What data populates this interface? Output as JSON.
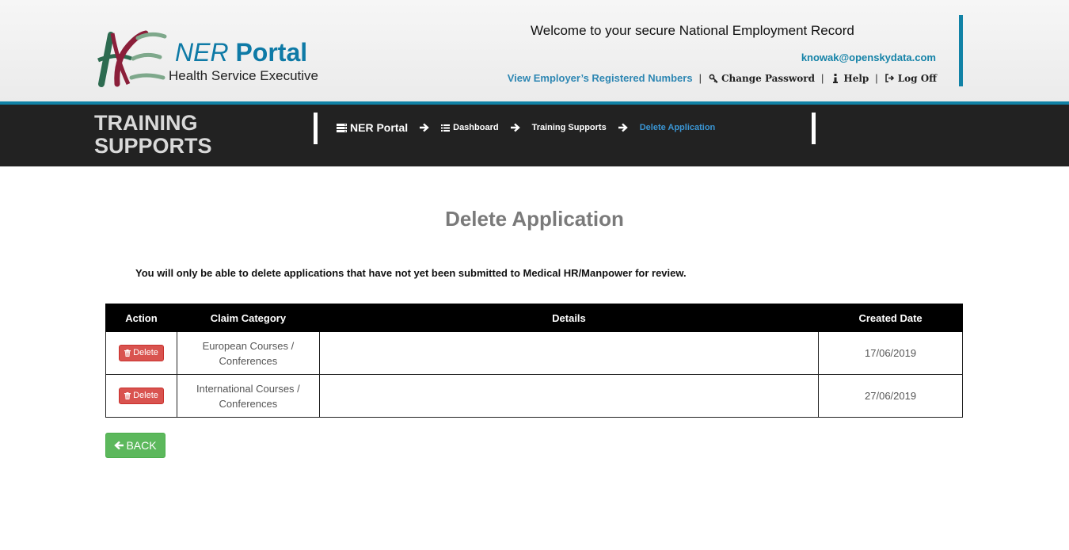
{
  "header": {
    "logo_title_italic": "NER",
    "logo_title_bold": "Portal",
    "logo_subtitle": "Health Service Executive",
    "welcome": "Welcome to your secure National Employment Record",
    "user_email": "knowak@openskydata.com",
    "links": {
      "registered_numbers": "View Employer’s Registered Numbers",
      "change_password": "Change Password",
      "help": "Help",
      "log_off": "Log Off",
      "separator": "|"
    }
  },
  "nav": {
    "section_title_line1": "TRAINING",
    "section_title_line2": "SUPPORTS",
    "breadcrumb": [
      "NER Portal",
      "Dashboard",
      "Training Supports",
      "Delete Application"
    ]
  },
  "main": {
    "page_title": "Delete Application",
    "note": "You will only be able to delete applications that have not yet been submitted to Medical HR/Manpower for review.",
    "table": {
      "headers": [
        "Action",
        "Claim Category",
        "Details",
        "Created Date"
      ],
      "rows": [
        {
          "action": "Delete",
          "category_line1": "European Courses /",
          "category_line2": "Conferences",
          "details": "",
          "created": "17/06/2019"
        },
        {
          "action": "Delete",
          "category_line1": "International Courses /",
          "category_line2": "Conferences",
          "details": "",
          "created": "27/06/2019"
        }
      ]
    },
    "back_label": "BACK"
  },
  "colors": {
    "accent": "#1182a6",
    "nav_bg": "#222222",
    "delete": "#d9534f",
    "back": "#5cb85c",
    "current_crumb": "#3a95d3"
  },
  "icons": [
    "hse-logo",
    "key-icon",
    "info-icon",
    "sign-out-icon",
    "server-icon",
    "list-icon",
    "arrow-right-icon",
    "trash-icon",
    "arrow-left-icon"
  ]
}
